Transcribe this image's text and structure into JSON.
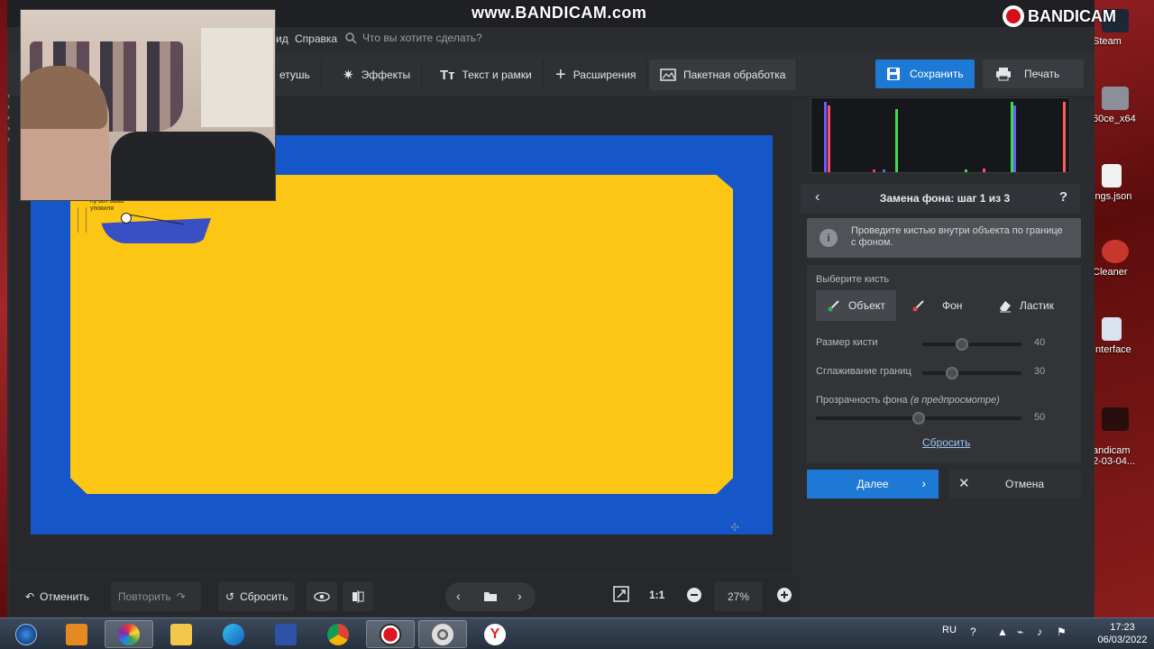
{
  "watermark": {
    "url": "www.BANDICAM.com",
    "logo": "BANDICAM"
  },
  "desktop_icons": [
    {
      "label": "Steam",
      "icon": "steam-icon",
      "color": "#1b2838"
    },
    {
      "label": "60ce_x64",
      "icon": "controller-icon",
      "color": "#8a8f99"
    },
    {
      "label": "ings.json",
      "icon": "file-icon",
      "color": "#f1f1f1"
    },
    {
      "label": "Cleaner",
      "icon": "ccleaner-icon",
      "color": "#c8372d"
    },
    {
      "label": "Interface",
      "icon": "document-icon",
      "color": "#d9e3ef"
    },
    {
      "label": "andicam\n2-03-04...",
      "icon": "bandicam-file-icon",
      "color": "#2a0d0d"
    }
  ],
  "menu": {
    "item_partial": "ид",
    "help": "Справка",
    "search_placeholder": "Что вы хотите сделать?"
  },
  "toolbar": {
    "tabs": [
      {
        "label": "етушь",
        "icon": "retouch-icon"
      },
      {
        "label": "Эффекты",
        "icon": "effects-wand-icon"
      },
      {
        "label": "Текст и рамки",
        "icon": "text-icon"
      },
      {
        "label": "Расширения",
        "icon": "plus-icon"
      },
      {
        "label": "Пакетная обработка",
        "icon": "batch-image-icon"
      }
    ],
    "save_label": "Сохранить",
    "print_label": "Печать"
  },
  "canvas": {
    "caption_line1": "ну вот вааа",
    "caption_line2": "упокиля"
  },
  "panel": {
    "step_title": "Замена фона: шаг 1 из 3",
    "help_glyph": "?",
    "hint": "Проведите кистью внутри объекта по границе с фоном.",
    "choose_brush_label": "Выберите кисть",
    "brushes": [
      {
        "label": "Объект",
        "icon": "brush-object-icon",
        "dot": "#2fb34a",
        "active": true
      },
      {
        "label": "Фон",
        "icon": "brush-background-icon",
        "dot": "#e5483b",
        "active": false
      },
      {
        "label": "Ластик",
        "icon": "eraser-icon",
        "dot": "",
        "active": false
      }
    ],
    "brush_size": {
      "label": "Размер кисти",
      "value": "40",
      "fraction": 0.4
    },
    "edge_smoothing": {
      "label": "Сглаживание границ",
      "value": "30",
      "fraction": 0.3
    },
    "bg_transparency": {
      "label": "Прозрачность фона",
      "label_italic": "(в предпросмотре)",
      "value": "50",
      "fraction": 0.5
    },
    "reset_link": "Сбросить",
    "next_label": "Далее",
    "cancel_label": "Отмена"
  },
  "bottombar": {
    "undo_label": "Отменить",
    "redo_label": "Повторить",
    "reset_label": "Сбросить",
    "zoom_ratio": "1:1",
    "zoom_value": "27%"
  },
  "taskbar": {
    "apps": [
      "windows-start-icon",
      "media-player-icon",
      "photo-editor-icon",
      "file-explorer-icon",
      "edge-icon",
      "save-app-icon",
      "chrome-icon",
      "bandicam-record-icon",
      "film-reel-icon",
      "yandex-icon"
    ],
    "lang": "RU",
    "time": "17:23",
    "date": "06/03/2022"
  },
  "histogram": {
    "bars": [
      {
        "pos": 0.05,
        "h": 0.95,
        "color": "#6a5cff"
      },
      {
        "pos": 0.065,
        "h": 0.9,
        "color": "#ff4f6a"
      },
      {
        "pos": 0.24,
        "h": 0.04,
        "color": "#e24b4b"
      },
      {
        "pos": 0.28,
        "h": 0.04,
        "color": "#4b6bff"
      },
      {
        "pos": 0.33,
        "h": 0.85,
        "color": "#3ddc4b"
      },
      {
        "pos": 0.6,
        "h": 0.04,
        "color": "#3ddc4b"
      },
      {
        "pos": 0.67,
        "h": 0.05,
        "color": "#ff4f6a"
      },
      {
        "pos": 0.78,
        "h": 0.95,
        "color": "#3ddc4b"
      },
      {
        "pos": 0.79,
        "h": 0.9,
        "color": "#6a5cff"
      },
      {
        "pos": 0.985,
        "h": 0.95,
        "color": "#ff5a5a"
      }
    ]
  }
}
